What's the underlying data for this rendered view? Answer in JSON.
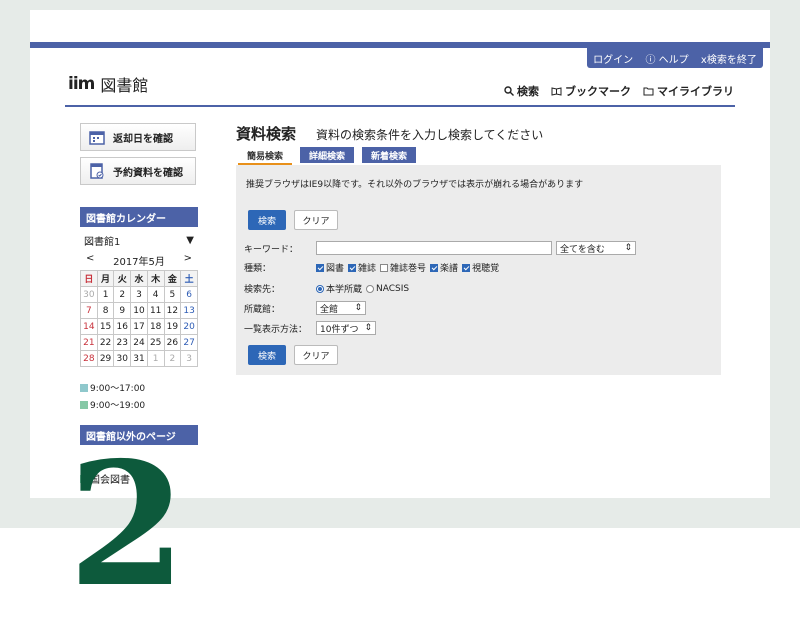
{
  "toolbar": {
    "login": "ログイン",
    "help": "ヘルプ",
    "exit": "x検索を終了"
  },
  "logo": {
    "mark": "iim",
    "text": "図書館"
  },
  "nav": {
    "search": "検索",
    "bookmark": "ブックマーク",
    "mylibrary": "マイライブラリ"
  },
  "sidebar": {
    "return_date": "返却日を確認",
    "reserved": "予約資料を確認",
    "calendar_head": "図書館カレンダー",
    "library_select": "図書館1",
    "prev": "<",
    "month": "2017年5月",
    "next": ">",
    "weekdays": [
      "日",
      "月",
      "火",
      "水",
      "木",
      "金",
      "土"
    ],
    "weeks": [
      [
        "30",
        "1",
        "2",
        "3",
        "4",
        "5",
        "6"
      ],
      [
        "7",
        "8",
        "9",
        "10",
        "11",
        "12",
        "13"
      ],
      [
        "14",
        "15",
        "16",
        "17",
        "18",
        "19",
        "20"
      ],
      [
        "21",
        "22",
        "23",
        "24",
        "25",
        "26",
        "27"
      ],
      [
        "28",
        "29",
        "30",
        "31",
        "1",
        "2",
        "3"
      ]
    ],
    "hours_1": "9:00〜17:00",
    "hours_2": "9:00〜19:00",
    "other_head": "図書館以外のページ",
    "link_1": "国会図書",
    "colors": {
      "hours_1": "#8fc8cc",
      "hours_2": "#86c8a6"
    }
  },
  "main": {
    "title": "資料検索",
    "subtitle": "資料の検索条件を入力し検索してください",
    "tabs": [
      "簡易検索",
      "詳細検索",
      "新着検索"
    ],
    "note": "推奨ブラウザはIE9以降です。それ以外のブラウザでは表示が崩れる場合があります",
    "search_btn": "検索",
    "clear_btn": "クリア",
    "keyword_label": "キーワード：",
    "match_select": "全てを含む",
    "type_label": "種類：",
    "types": [
      "図書",
      "雑誌",
      "雑誌巻号",
      "楽譜",
      "視聴覚"
    ],
    "target_label": "検索先：",
    "targets": [
      "本学所蔵",
      "NACSIS"
    ],
    "location_label": "所蔵館：",
    "location_select": "全館",
    "display_label": "一覧表示方法：",
    "display_select": "10件ずつ"
  },
  "overlay_number": "2",
  "colors": {
    "accent": "#4c62a7",
    "button": "#2d67b7",
    "number": "#0d5a3c"
  }
}
